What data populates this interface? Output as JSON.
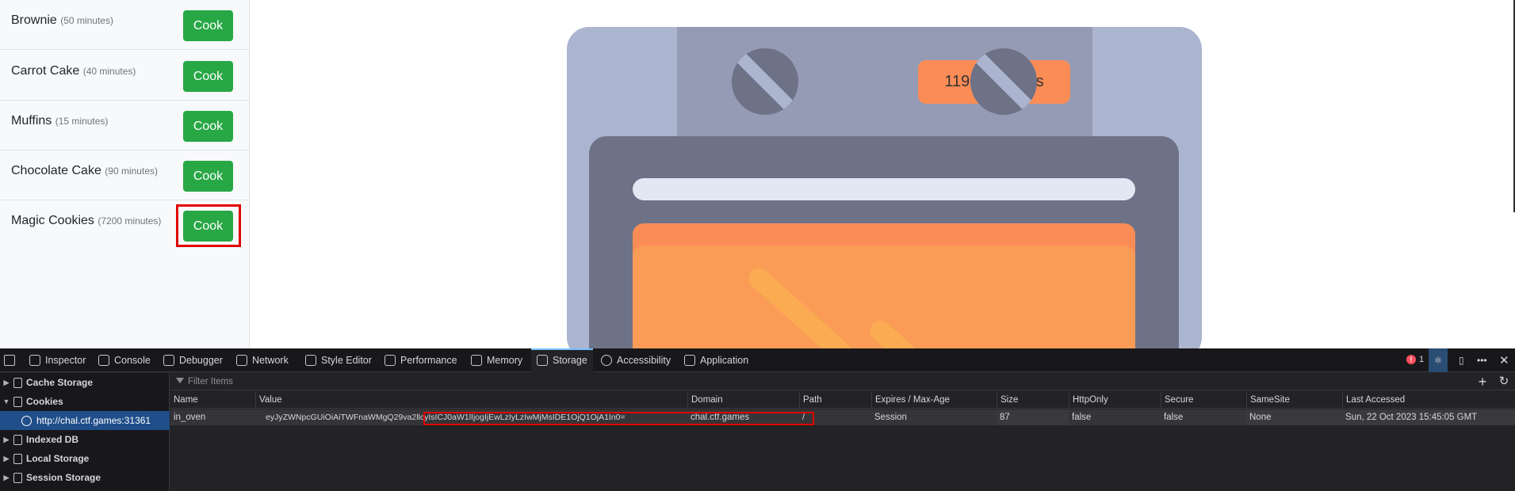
{
  "recipes": [
    {
      "name": "Brownie",
      "time": "(50 minutes)",
      "button": "Cook"
    },
    {
      "name": "Carrot Cake",
      "time": "(40 minutes)",
      "button": "Cook"
    },
    {
      "name": "Muffins",
      "time": "(15 minutes)",
      "button": "Cook"
    },
    {
      "name": "Chocolate Cake",
      "time": "(90 minutes)",
      "button": "Cook"
    },
    {
      "name": "Magic Cookies",
      "time": "(7200 minutes)",
      "button": "Cook"
    }
  ],
  "oven": {
    "timer": "119h 59m 48s"
  },
  "devtools": {
    "tabs": [
      "Inspector",
      "Console",
      "Debugger",
      "Network",
      "Style Editor",
      "Performance",
      "Memory",
      "Storage",
      "Accessibility",
      "Application"
    ],
    "selected_tab": "Storage",
    "error_count": "1",
    "sidebar": {
      "cache_storage": "Cache Storage",
      "cookies": "Cookies",
      "cookie_host": "http://chal.ctf.games:31361",
      "indexed_db": "Indexed DB",
      "local_storage": "Local Storage",
      "session_storage": "Session Storage"
    },
    "filter_placeholder": "Filter Items",
    "columns": [
      "Name",
      "Value",
      "Domain",
      "Path",
      "Expires / Max-Age",
      "Size",
      "HttpOnly",
      "Secure",
      "SameSite",
      "Last Accessed"
    ],
    "cookie_row": {
      "name": "in_oven",
      "value": "eyJyZWNpcGUiOiAiTWFnaWMgQ29va2llcyIsICJ0aW1lIjogIjEwLzIyLzIwMjMsIDE1OjQ1OjA1In0=",
      "domain": "chal.ctf.games",
      "path": "/",
      "expires": "Session",
      "size": "87",
      "httponly": "false",
      "secure": "false",
      "samesite": "None",
      "last_accessed": "Sun, 22 Oct 2023 15:45:05 GMT"
    }
  },
  "colors": {
    "cook_button": "#28a745",
    "timer": "#fb8c56",
    "highlight": "#e10000",
    "devtools_bg": "#232327"
  }
}
